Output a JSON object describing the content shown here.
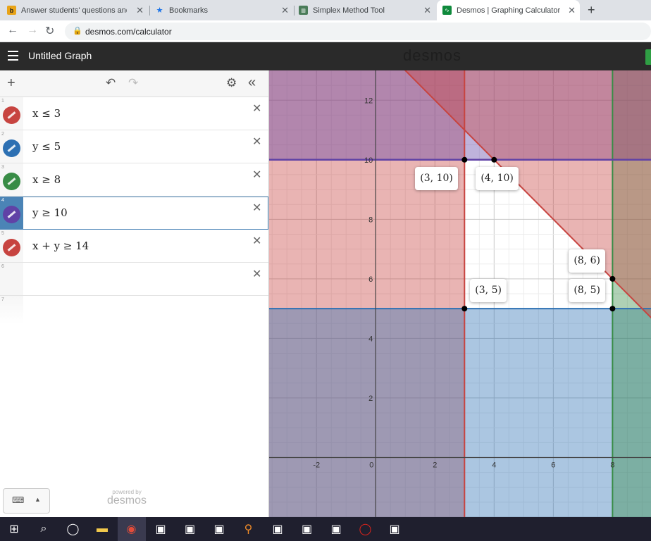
{
  "browser": {
    "tabs": [
      {
        "title": "Answer students' questions and I",
        "icon": "brainly-icon",
        "color": "#e8a317"
      },
      {
        "title": "Bookmarks",
        "icon": "star-icon",
        "color": "#1a73e8"
      },
      {
        "title": "Simplex Method Tool",
        "icon": "tool-icon",
        "color": "#4a7c59"
      },
      {
        "title": "Desmos | Graphing Calculator",
        "icon": "desmos-icon",
        "color": "#0f8a3c",
        "active": true
      }
    ],
    "url": "desmos.com/calculator"
  },
  "desmos": {
    "title": "Untitled Graph",
    "logo": "desmos",
    "powered_by": "powered by",
    "powered_logo": "desmos",
    "expressions": [
      {
        "num": "1",
        "latex": "x ≤ 3",
        "color": "#c74440"
      },
      {
        "num": "2",
        "latex": "y ≤ 5",
        "color": "#2d70b3"
      },
      {
        "num": "3",
        "latex": "x ≥ 8",
        "color": "#388c46"
      },
      {
        "num": "4",
        "latex": "y ≥ 10",
        "color": "#6042a6",
        "selected": true
      },
      {
        "num": "5",
        "latex": "x + y ≥ 14",
        "color": "#c74440"
      },
      {
        "num": "6",
        "latex": ""
      },
      {
        "num": "7",
        "latex": ""
      }
    ]
  },
  "graph": {
    "x_range": [
      -3.6,
      9.3
    ],
    "y_range": [
      -2,
      13
    ],
    "x_ticks": [
      "-2",
      "0",
      "2",
      "4",
      "6",
      "8"
    ],
    "y_ticks": [
      "2",
      "4",
      "6",
      "8",
      "10",
      "12"
    ],
    "points": [
      {
        "label": "(3, 10)",
        "x": 3,
        "y": 10
      },
      {
        "label": "(4, 10)",
        "x": 4,
        "y": 10
      },
      {
        "label": "(8, 6)",
        "x": 8,
        "y": 6
      },
      {
        "label": "(3, 5)",
        "x": 3,
        "y": 5
      },
      {
        "label": "(8, 5)",
        "x": 8,
        "y": 5
      }
    ]
  },
  "taskbar": {
    "items": [
      "windows-icon",
      "search-icon",
      "task-view-icon",
      "file-explorer-icon",
      "chrome-icon",
      "app-icon",
      "app-icon",
      "app-icon",
      "search-app-icon",
      "app-icon",
      "app-icon",
      "app-icon",
      "opera-icon",
      "app-icon"
    ]
  }
}
